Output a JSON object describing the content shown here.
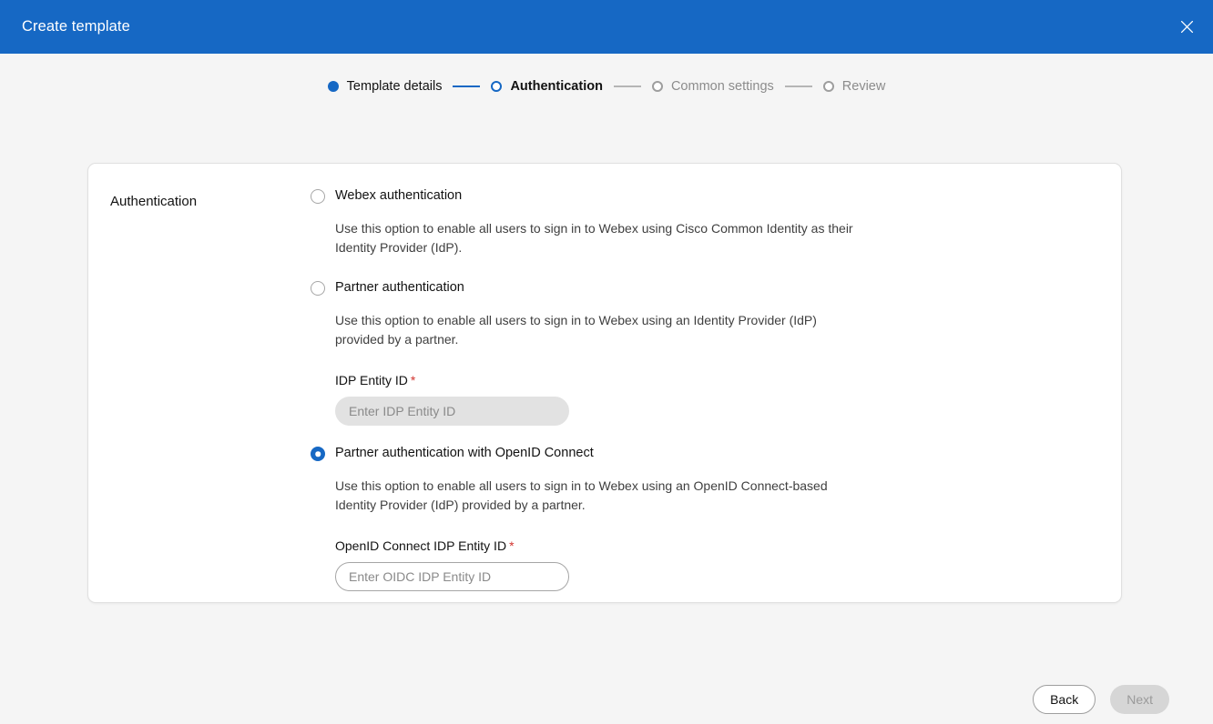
{
  "window": {
    "title": "Create template",
    "close_icon": "close-icon",
    "header_color": "#1668c4"
  },
  "stepper": {
    "steps": [
      {
        "label": "Template details",
        "state": "done"
      },
      {
        "label": "Authentication",
        "state": "active"
      },
      {
        "label": "Common settings",
        "state": "todo"
      },
      {
        "label": "Review",
        "state": "todo"
      }
    ],
    "active_color": "#1668c4",
    "inactive_color": "#8c8c8c"
  },
  "card": {
    "section_label": "Authentication",
    "options": [
      {
        "label": "Webex authentication",
        "selected": false,
        "description": "Use this option to enable all users to sign in to Webex using Cisco Common Identity as their Identity Provider (IdP)."
      },
      {
        "label": "Partner authentication",
        "selected": false,
        "description": "Use this option to enable all users to sign in to Webex using an Identity Provider (IdP) provided by a partner.",
        "field": {
          "label": "IDP Entity ID",
          "required_marker": "*",
          "placeholder": "Enter IDP Entity ID",
          "value": "",
          "disabled": true
        }
      },
      {
        "label": "Partner authentication with OpenID Connect",
        "selected": true,
        "description": "Use this option to enable all users to sign in to Webex using an OpenID Connect-based Identity Provider (IdP) provided by a partner.",
        "field": {
          "label": "OpenID Connect IDP Entity ID",
          "required_marker": "*",
          "placeholder": "Enter OIDC IDP Entity ID",
          "value": "",
          "disabled": false
        }
      }
    ]
  },
  "footer": {
    "back_label": "Back",
    "next_label": "Next",
    "next_disabled": true
  }
}
